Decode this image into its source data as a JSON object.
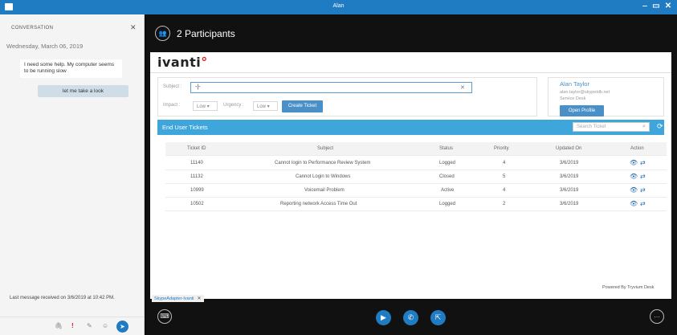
{
  "window": {
    "title": "Alan"
  },
  "conversation": {
    "label": "CONVERSATION",
    "date": "Wednesday, March 06, 2019",
    "messages": [
      {
        "text": "I need some help.  My computer seems to be running slow"
      },
      {
        "text": "let me take a look"
      }
    ],
    "last_message": "Last message received on 3/6/2019 at 10:42 PM."
  },
  "participants": {
    "title": "2 Participants"
  },
  "brand": {
    "logo": "ivanti",
    "accent": "#e2241a"
  },
  "form": {
    "subject_label": "Subject :",
    "subject_value": "-|-",
    "impact_label": "Impact :",
    "impact_value": "Low",
    "urgency_label": "Urgency :",
    "urgency_value": "Low",
    "create_label": "Create Ticket"
  },
  "profile": {
    "name": "Alan Taylor",
    "email": "alan.taylor@skypetdb.net",
    "team": "Service Desk",
    "open_label": "Open Profile"
  },
  "tickets": {
    "title": "End User Tickets",
    "search_placeholder": "Search Ticket",
    "columns": [
      "Ticket ID",
      "Subject",
      "Status",
      "Priority",
      "Updated On",
      "Action"
    ],
    "rows": [
      {
        "id": "11140",
        "subject": "Cannot login to Performance Review System",
        "status": "Logged",
        "priority": "4",
        "updated": "3/6/2019"
      },
      {
        "id": "11132",
        "subject": "Cannot Login to Windows",
        "status": "Closed",
        "priority": "5",
        "updated": "3/6/2019"
      },
      {
        "id": "10999",
        "subject": "Voicemail Problem",
        "status": "Active",
        "priority": "4",
        "updated": "3/6/2019"
      },
      {
        "id": "10502",
        "subject": "Reporting network Access Time Out",
        "status": "Logged",
        "priority": "2",
        "updated": "3/6/2019"
      }
    ]
  },
  "footer": {
    "powered": "Powered By Tryvium Desk",
    "tab_label": "SkypeAdapter-Ivanti"
  },
  "colors": {
    "accent": "#1f7bc2",
    "header_bar": "#3fa6dc"
  }
}
